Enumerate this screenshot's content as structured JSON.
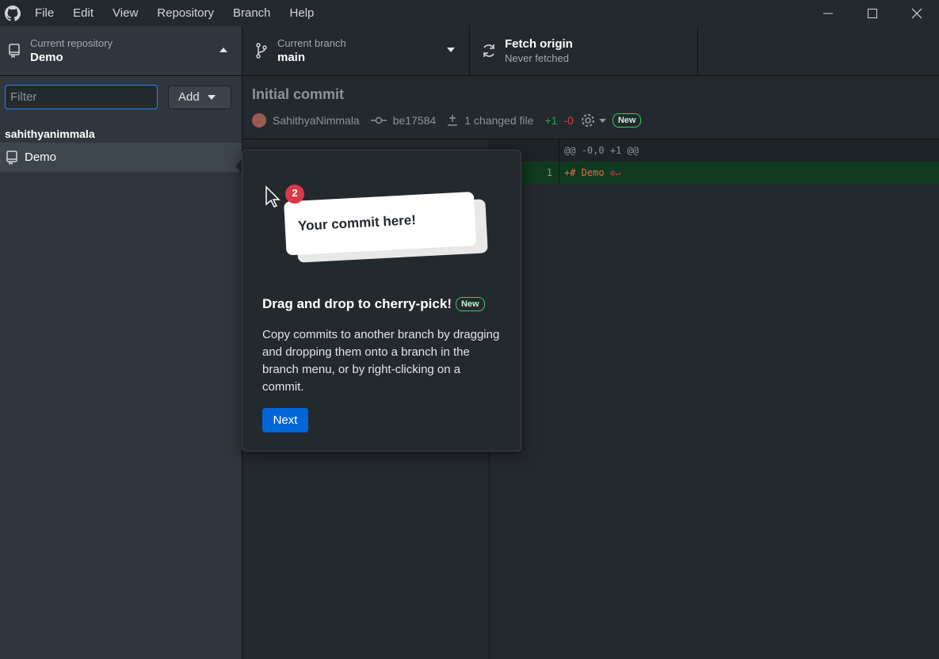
{
  "menu": [
    "File",
    "Edit",
    "View",
    "Repository",
    "Branch",
    "Help"
  ],
  "toolbar": {
    "repo_label": "Current repository",
    "repo_value": "Demo",
    "branch_label": "Current branch",
    "branch_value": "main",
    "fetch_label": "Fetch origin",
    "fetch_value": "Never fetched"
  },
  "sidebar": {
    "filter_placeholder": "Filter",
    "add_label": "Add",
    "group": "sahithyanimmala",
    "repos": [
      "Demo"
    ]
  },
  "commit": {
    "title": "Initial commit",
    "author": "SahithyaNimmala",
    "sha": "be17584",
    "changed": "1 changed file",
    "additions": "+1",
    "deletions": "-0",
    "badge": "New"
  },
  "diff": {
    "hunk": "@@ -0,0 +1 @@",
    "line_no": "1",
    "line": "+# Demo"
  },
  "popover": {
    "card_text": "Your commit here!",
    "count": "2",
    "title": "Drag and drop to cherry-pick!",
    "badge": "New",
    "body": "Copy commits to another branch by dragging and dropping them onto a branch in the branch menu, or by right-clicking on a commit.",
    "next": "Next"
  },
  "icons": [
    "github-logo-icon",
    "repo-icon",
    "branch-icon",
    "sync-icon",
    "commit-icon",
    "diff-icon",
    "gear-icon",
    "cursor-icon"
  ]
}
